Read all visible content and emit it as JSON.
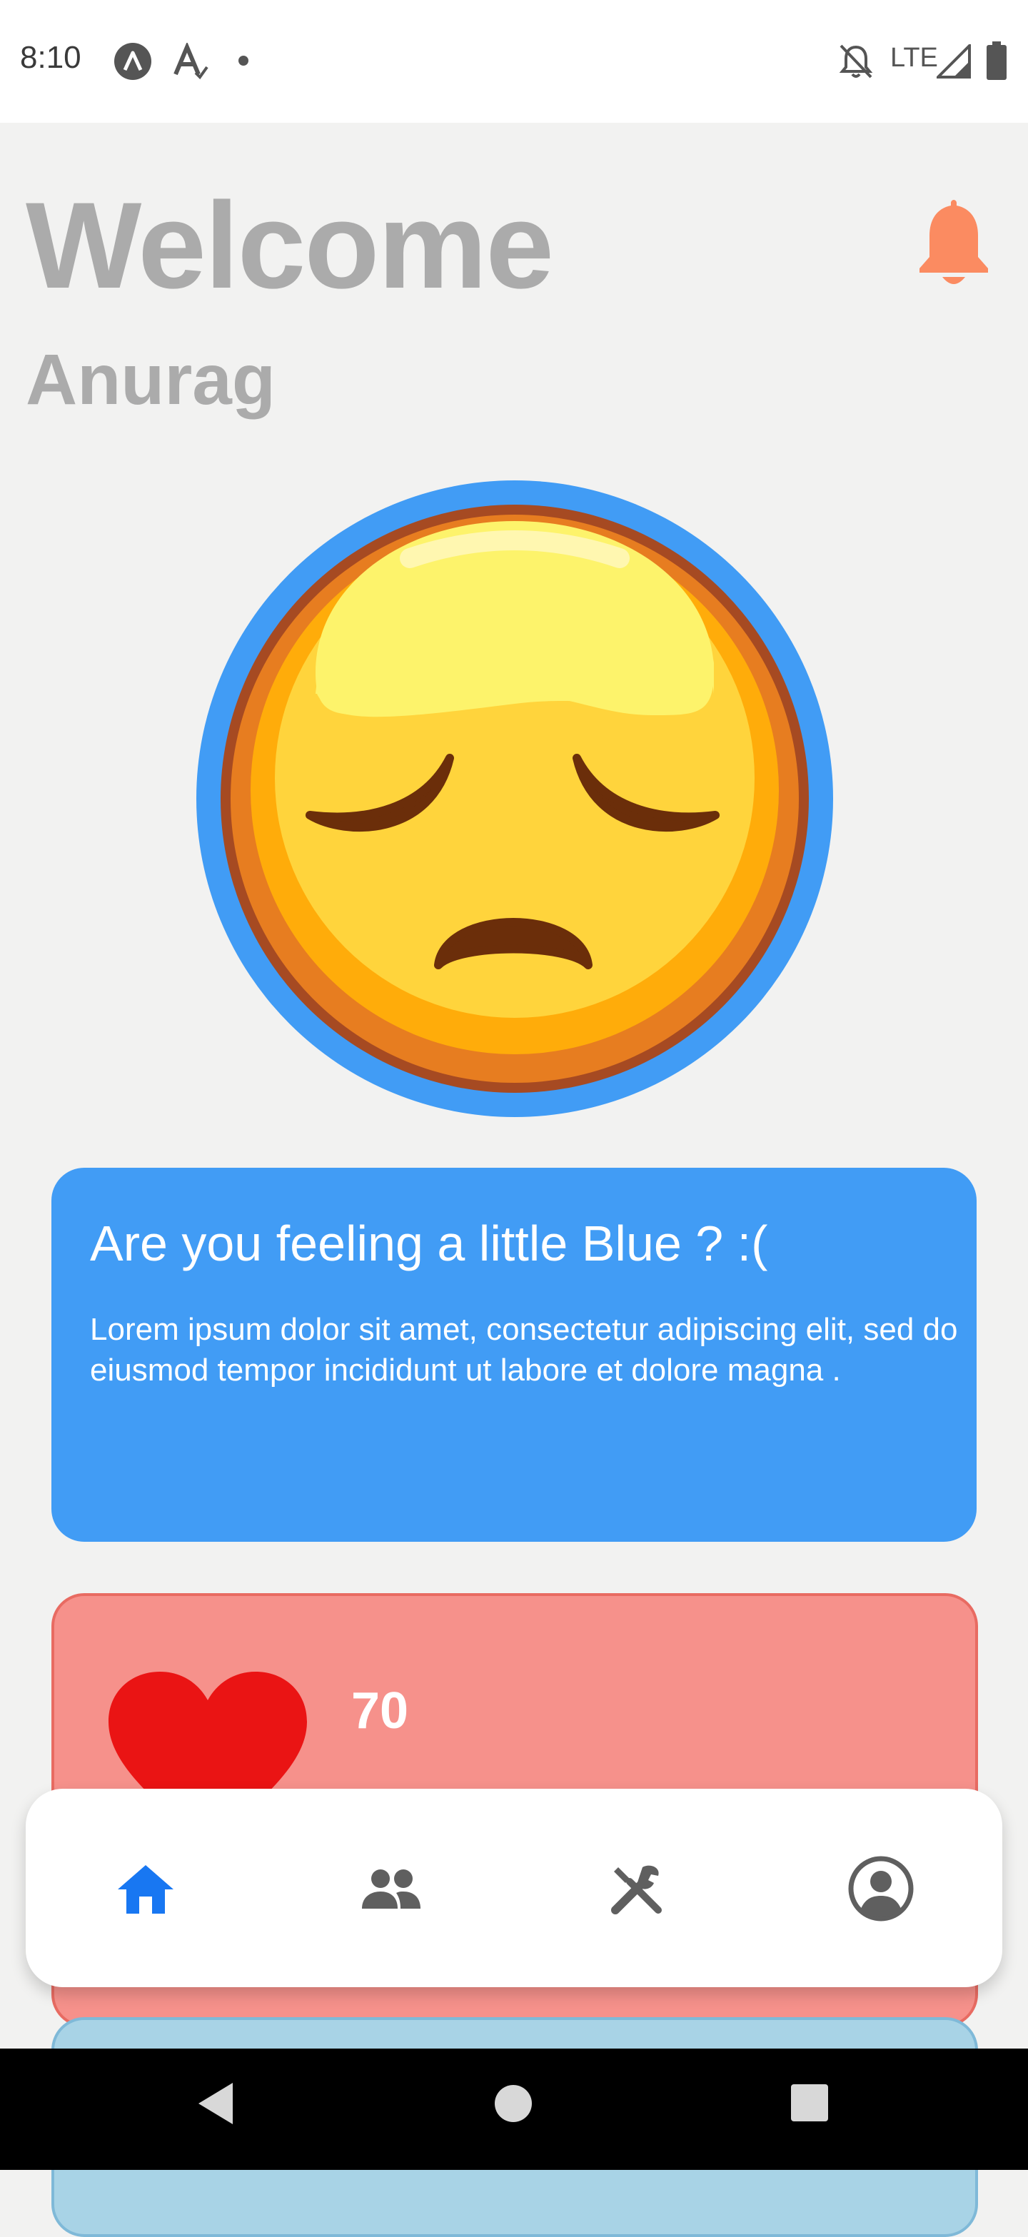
{
  "status_bar": {
    "time": "8:10",
    "network": "LTE",
    "icons": [
      "app-a-icon",
      "font-a-icon",
      "dot-icon",
      "bell-off-icon",
      "signal-icon",
      "battery-icon"
    ]
  },
  "header": {
    "greeting": "Welcome",
    "username": "Anurag",
    "notification_icon": "bell-icon"
  },
  "mood": {
    "emoji_icon": "sad-face-icon",
    "title": "Are you feeling a little Blue ? :(",
    "description": "Lorem ipsum dolor sit amet, consectetur adipiscing elit, sed do eiusmod tempor incididunt ut labore et dolore magna ."
  },
  "heart_card": {
    "icon": "heart-icon",
    "value": "70"
  },
  "bottom_nav": {
    "items": [
      {
        "icon": "home-icon",
        "active": true
      },
      {
        "icon": "people-icon",
        "active": false
      },
      {
        "icon": "tools-icon",
        "active": false
      },
      {
        "icon": "account-icon",
        "active": false
      }
    ]
  },
  "colors": {
    "accent": "#1877f2",
    "mood_card": "#419cf5",
    "heart_card": "#f6918b",
    "bell": "#fb8b61",
    "heading": "#ababab"
  }
}
